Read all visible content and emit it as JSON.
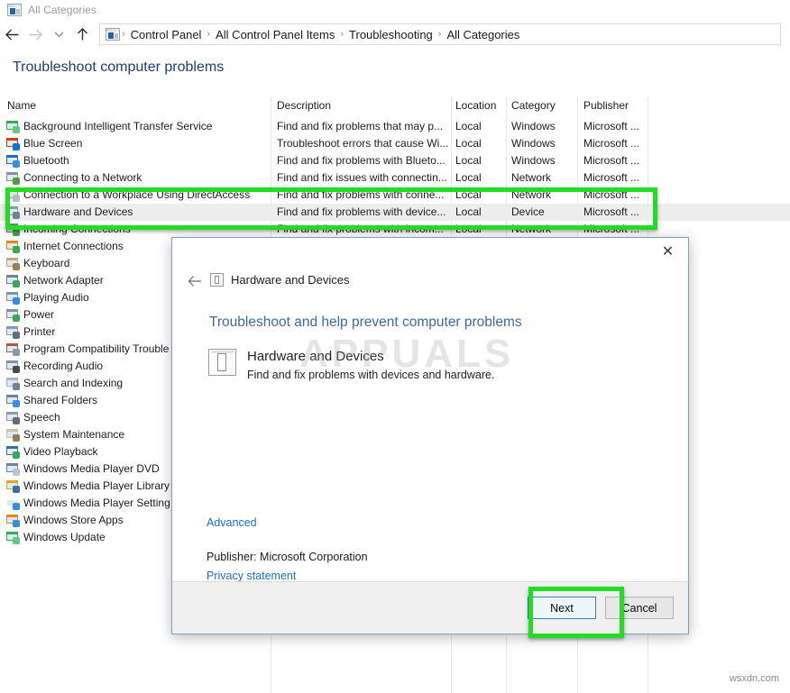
{
  "window": {
    "title": "All Categories",
    "icon": "control-panel-icon"
  },
  "nav": {
    "back_icon": "back-arrow-icon",
    "forward_icon": "forward-arrow-icon",
    "recent_icon": "chevron-down-icon",
    "up_icon": "up-arrow-icon",
    "breadcrumbs": [
      "Control Panel",
      "All Control Panel Items",
      "Troubleshooting",
      "All Categories"
    ],
    "separator": "›"
  },
  "page": {
    "heading": "Troubleshoot computer problems"
  },
  "list": {
    "columns": [
      "Name",
      "Description",
      "Location",
      "Category",
      "Publisher"
    ],
    "rows": [
      {
        "name": "Background Intelligent Transfer Service",
        "desc": "Find and fix problems that may p...",
        "loc": "Local",
        "cat": "Windows",
        "pub": "Microsoft ...",
        "icon": "bits-icon",
        "selected": false
      },
      {
        "name": "Blue Screen",
        "desc": "Troubleshoot errors that cause Wi...",
        "loc": "Local",
        "cat": "Windows",
        "pub": "Microsoft ...",
        "icon": "windows-logo-icon",
        "selected": false
      },
      {
        "name": "Bluetooth",
        "desc": "Find and fix problems with Blueto...",
        "loc": "Local",
        "cat": "Windows",
        "pub": "Microsoft ...",
        "icon": "bluetooth-icon",
        "selected": false
      },
      {
        "name": "Connecting to a Network",
        "desc": "Find and fix issues with connectin...",
        "loc": "Local",
        "cat": "Network",
        "pub": "Microsoft ...",
        "icon": "network-icon",
        "selected": false
      },
      {
        "name": "Connection to a Workplace Using DirectAccess",
        "desc": "Find and fix problems with conne...",
        "loc": "Local",
        "cat": "Network",
        "pub": "Microsoft ...",
        "icon": "workplace-icon",
        "selected": false
      },
      {
        "name": "Hardware and Devices",
        "desc": "Find and fix problems with device...",
        "loc": "Local",
        "cat": "Device",
        "pub": "Microsoft ...",
        "icon": "device-icon",
        "selected": true
      },
      {
        "name": "Incoming Connections",
        "desc": "Find and fix problems with incom...",
        "loc": "Local",
        "cat": "Network",
        "pub": "Microsoft ...",
        "icon": "incoming-icon",
        "selected": false
      },
      {
        "name": "Internet Connections",
        "desc": "",
        "loc": "",
        "cat": "",
        "pub": "",
        "icon": "internet-icon",
        "selected": false
      },
      {
        "name": "Keyboard",
        "desc": "",
        "loc": "",
        "cat": "",
        "pub": "",
        "icon": "keyboard-icon",
        "selected": false
      },
      {
        "name": "Network Adapter",
        "desc": "",
        "loc": "",
        "cat": "",
        "pub": "",
        "icon": "network-adapter-icon",
        "selected": false
      },
      {
        "name": "Playing Audio",
        "desc": "",
        "loc": "",
        "cat": "",
        "pub": "",
        "icon": "speaker-icon",
        "selected": false
      },
      {
        "name": "Power",
        "desc": "",
        "loc": "",
        "cat": "",
        "pub": "",
        "icon": "power-icon",
        "selected": false
      },
      {
        "name": "Printer",
        "desc": "",
        "loc": "",
        "cat": "",
        "pub": "",
        "icon": "printer-icon",
        "selected": false
      },
      {
        "name": "Program Compatibility Trouble",
        "desc": "",
        "loc": "",
        "cat": "",
        "pub": "",
        "icon": "program-compat-icon",
        "selected": false
      },
      {
        "name": "Recording Audio",
        "desc": "",
        "loc": "",
        "cat": "",
        "pub": "",
        "icon": "microphone-icon",
        "selected": false
      },
      {
        "name": "Search and Indexing",
        "desc": "",
        "loc": "",
        "cat": "",
        "pub": "",
        "icon": "search-icon",
        "selected": false
      },
      {
        "name": "Shared Folders",
        "desc": "",
        "loc": "",
        "cat": "",
        "pub": "",
        "icon": "shared-folders-icon",
        "selected": false
      },
      {
        "name": "Speech",
        "desc": "",
        "loc": "",
        "cat": "",
        "pub": "",
        "icon": "speech-icon",
        "selected": false
      },
      {
        "name": "System Maintenance",
        "desc": "",
        "loc": "",
        "cat": "",
        "pub": "",
        "icon": "system-maintenance-icon",
        "selected": false
      },
      {
        "name": "Video Playback",
        "desc": "",
        "loc": "",
        "cat": "",
        "pub": "",
        "icon": "video-playback-icon",
        "selected": false
      },
      {
        "name": "Windows Media Player DVD",
        "desc": "",
        "loc": "",
        "cat": "",
        "pub": "",
        "icon": "wmp-dvd-icon",
        "selected": false
      },
      {
        "name": "Windows Media Player Library",
        "desc": "",
        "loc": "",
        "cat": "",
        "pub": "",
        "icon": "wmp-library-icon",
        "selected": false
      },
      {
        "name": "Windows Media Player Setting",
        "desc": "",
        "loc": "",
        "cat": "",
        "pub": "",
        "icon": "wmp-settings-icon",
        "selected": false
      },
      {
        "name": "Windows Store Apps",
        "desc": "",
        "loc": "",
        "cat": "",
        "pub": "",
        "icon": "store-icon",
        "selected": false
      },
      {
        "name": "Windows Update",
        "desc": "",
        "loc": "",
        "cat": "",
        "pub": "",
        "icon": "windows-update-icon",
        "selected": false
      }
    ]
  },
  "dialog": {
    "close_label": "✕",
    "back_icon": "back-arrow-icon",
    "title": "Hardware and Devices",
    "heading": "Troubleshoot and help prevent computer problems",
    "item_title": "Hardware and Devices",
    "item_desc": "Find and fix problems with devices and hardware.",
    "advanced_link": "Advanced",
    "publisher": "Publisher:  Microsoft Corporation",
    "privacy_link": "Privacy statement",
    "next_label": "Next",
    "cancel_label": "Cancel"
  },
  "watermarks": {
    "center": "APPUALS",
    "corner": "wsxdn.com"
  },
  "colors": {
    "highlight_green": "#22dd22",
    "heading_blue": "#1a3f7a",
    "link_blue": "#1f6fc4",
    "selected_row": "#ededed"
  }
}
